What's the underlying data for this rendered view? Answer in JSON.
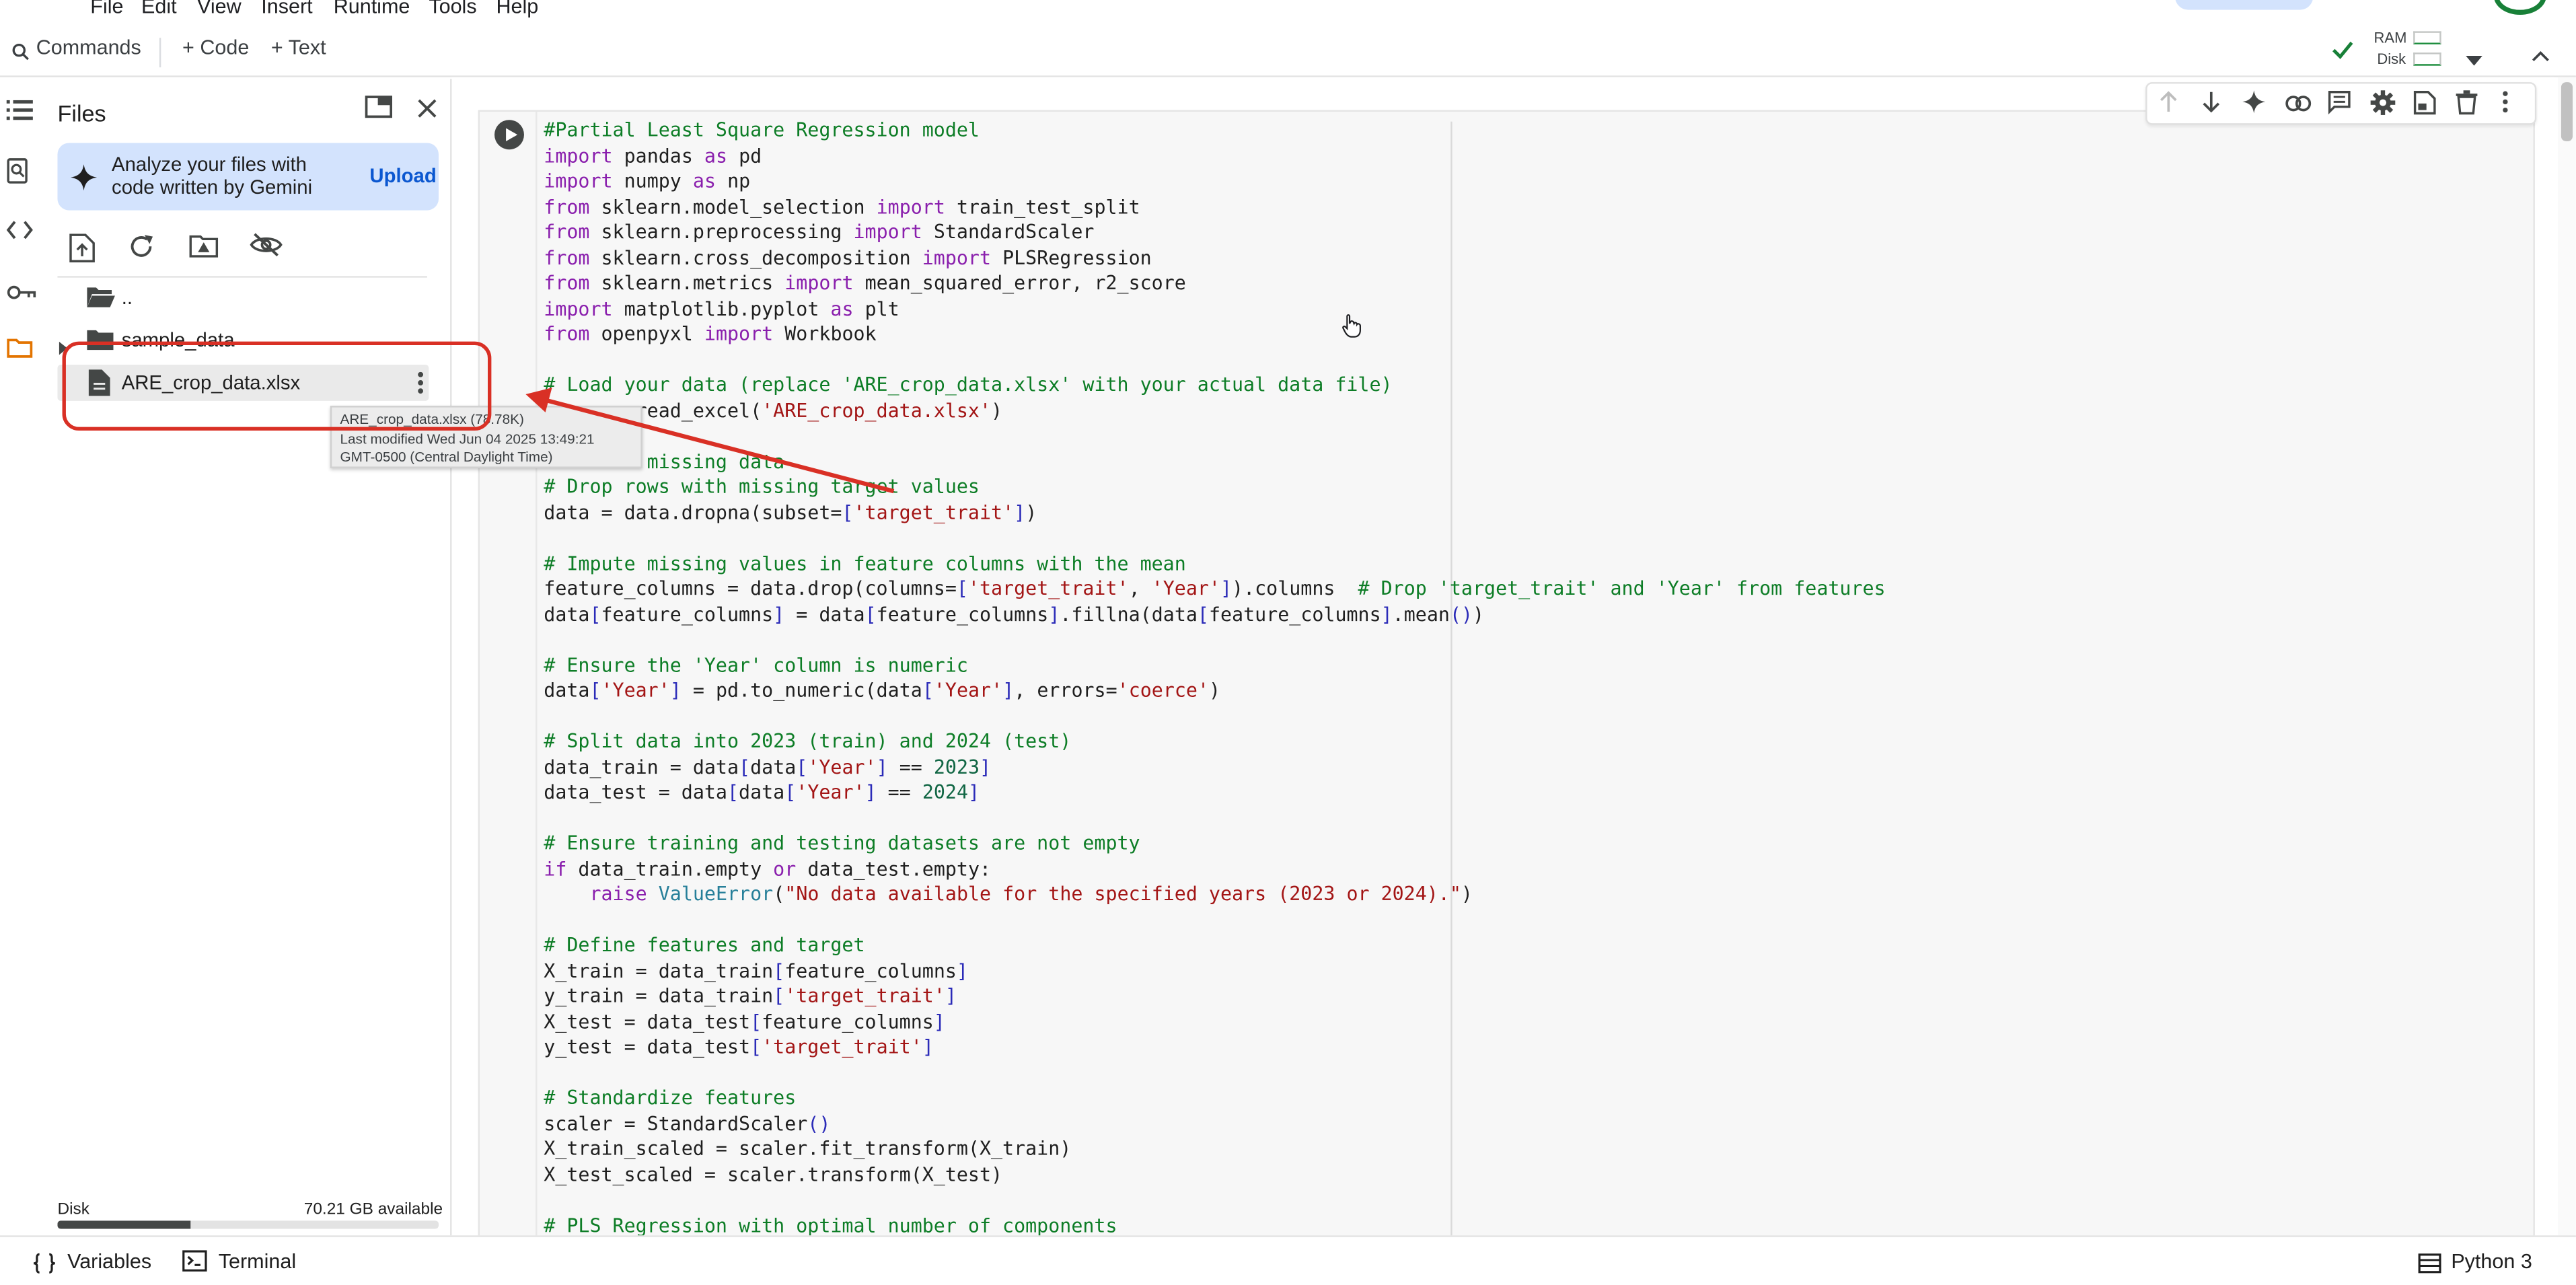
{
  "menu": [
    "File",
    "Edit",
    "View",
    "Insert",
    "Runtime",
    "Tools",
    "Help"
  ],
  "toolbar": {
    "commands_label": "Commands",
    "add_code_label": "+ Code",
    "add_text_label": "+ Text",
    "ram_label": "RAM",
    "disk_label": "Disk"
  },
  "rail": {
    "icons": [
      "table-of-contents-icon",
      "find-replace-icon",
      "code-snippets-icon",
      "secrets-key-icon",
      "folder-icon"
    ]
  },
  "files_panel": {
    "title": "Files",
    "gemini_text": "Analyze your files with code written by Gemini",
    "upload_label": "Upload",
    "tree": [
      {
        "label": "..",
        "type": "folder"
      },
      {
        "label": "sample_data",
        "type": "folder"
      },
      {
        "label": "ARE_crop_data.xlsx",
        "type": "file"
      }
    ],
    "disk_label": "Disk",
    "disk_available": "70.21 GB available",
    "disk_used_fraction": 0.35
  },
  "tooltip": {
    "line1": "ARE_crop_data.xlsx (78.78K)",
    "line2": "Last modified Wed Jun 04 2025 13:49:21",
    "line3": "GMT-0500 (Central Daylight Time)"
  },
  "code_lines": [
    [
      {
        "t": "#Partial Least Square Regression model",
        "c": "c-comment"
      }
    ],
    [
      {
        "t": "import",
        "c": "c-kw"
      },
      {
        "t": " pandas "
      },
      {
        "t": "as",
        "c": "c-kw"
      },
      {
        "t": " pd"
      }
    ],
    [
      {
        "t": "import",
        "c": "c-kw"
      },
      {
        "t": " numpy "
      },
      {
        "t": "as",
        "c": "c-kw"
      },
      {
        "t": " np"
      }
    ],
    [
      {
        "t": "from",
        "c": "c-kw"
      },
      {
        "t": " sklearn.model_selection "
      },
      {
        "t": "import",
        "c": "c-kw"
      },
      {
        "t": " train_test_split"
      }
    ],
    [
      {
        "t": "from",
        "c": "c-kw"
      },
      {
        "t": " sklearn.preprocessing "
      },
      {
        "t": "import",
        "c": "c-kw"
      },
      {
        "t": " StandardScaler"
      }
    ],
    [
      {
        "t": "from",
        "c": "c-kw"
      },
      {
        "t": " sklearn.cross_decomposition "
      },
      {
        "t": "import",
        "c": "c-kw"
      },
      {
        "t": " PLSRegression"
      }
    ],
    [
      {
        "t": "from",
        "c": "c-kw"
      },
      {
        "t": " sklearn.metrics "
      },
      {
        "t": "import",
        "c": "c-kw"
      },
      {
        "t": " mean_squared_error, r2_score"
      }
    ],
    [
      {
        "t": "import",
        "c": "c-kw"
      },
      {
        "t": " matplotlib.pyplot "
      },
      {
        "t": "as",
        "c": "c-kw"
      },
      {
        "t": " plt"
      }
    ],
    [
      {
        "t": "from",
        "c": "c-kw"
      },
      {
        "t": " openpyxl "
      },
      {
        "t": "import",
        "c": "c-kw"
      },
      {
        "t": " Workbook"
      }
    ],
    [],
    [
      {
        "t": "# Load your data (replace 'ARE_crop_data.xlsx' with your actual data file)",
        "c": "c-comment"
      }
    ],
    [
      {
        "t": "       .read_excel("
      },
      {
        "t": "'ARE_crop_data.xlsx'",
        "c": "c-str"
      },
      {
        "t": ")"
      }
    ],
    [],
    [
      {
        "t": "#        missing data",
        "c": "c-comment"
      }
    ],
    [
      {
        "t": "# Drop rows with missing target values",
        "c": "c-comment"
      }
    ],
    [
      {
        "t": "data = data.dropna(subset="
      },
      {
        "t": "[",
        "c": "c-blue"
      },
      {
        "t": "'target_trait'",
        "c": "c-str"
      },
      {
        "t": "]",
        "c": "c-blue"
      },
      {
        "t": ")"
      }
    ],
    [],
    [
      {
        "t": "# Impute missing values in feature columns with the mean",
        "c": "c-comment"
      }
    ],
    [
      {
        "t": "feature_columns = data.drop(columns="
      },
      {
        "t": "[",
        "c": "c-blue"
      },
      {
        "t": "'target_trait'",
        "c": "c-str"
      },
      {
        "t": ", "
      },
      {
        "t": "'Year'",
        "c": "c-str"
      },
      {
        "t": "]",
        "c": "c-blue"
      },
      {
        "t": ").columns  "
      },
      {
        "t": "# Drop 'target_trait' and 'Year' from features",
        "c": "c-comment"
      }
    ],
    [
      {
        "t": "data"
      },
      {
        "t": "[",
        "c": "c-blue"
      },
      {
        "t": "feature_columns"
      },
      {
        "t": "]",
        "c": "c-blue"
      },
      {
        "t": " = data"
      },
      {
        "t": "[",
        "c": "c-blue"
      },
      {
        "t": "feature_columns"
      },
      {
        "t": "]",
        "c": "c-blue"
      },
      {
        "t": ".fillna(data"
      },
      {
        "t": "[",
        "c": "c-blue"
      },
      {
        "t": "feature_columns"
      },
      {
        "t": "]",
        "c": "c-blue"
      },
      {
        "t": ".mean"
      },
      {
        "t": "()",
        "c": "c-blue"
      },
      {
        "t": ")"
      }
    ],
    [],
    [
      {
        "t": "# Ensure the 'Year' column is numeric",
        "c": "c-comment"
      }
    ],
    [
      {
        "t": "data"
      },
      {
        "t": "[",
        "c": "c-blue"
      },
      {
        "t": "'Year'",
        "c": "c-str"
      },
      {
        "t": "]",
        "c": "c-blue"
      },
      {
        "t": " = pd.to_numeric(data"
      },
      {
        "t": "[",
        "c": "c-blue"
      },
      {
        "t": "'Year'",
        "c": "c-str"
      },
      {
        "t": "]",
        "c": "c-blue"
      },
      {
        "t": ", errors="
      },
      {
        "t": "'coerce'",
        "c": "c-str"
      },
      {
        "t": ")"
      }
    ],
    [],
    [
      {
        "t": "# Split data into 2023 (train) and 2024 (test)",
        "c": "c-comment"
      }
    ],
    [
      {
        "t": "data_train = data"
      },
      {
        "t": "[",
        "c": "c-blue"
      },
      {
        "t": "data"
      },
      {
        "t": "[",
        "c": "c-blue"
      },
      {
        "t": "'Year'",
        "c": "c-str"
      },
      {
        "t": "]",
        "c": "c-blue"
      },
      {
        "t": " == "
      },
      {
        "t": "2023",
        "c": "c-num"
      },
      {
        "t": "]",
        "c": "c-blue"
      }
    ],
    [
      {
        "t": "data_test = data"
      },
      {
        "t": "[",
        "c": "c-blue"
      },
      {
        "t": "data"
      },
      {
        "t": "[",
        "c": "c-blue"
      },
      {
        "t": "'Year'",
        "c": "c-str"
      },
      {
        "t": "]",
        "c": "c-blue"
      },
      {
        "t": " == "
      },
      {
        "t": "2024",
        "c": "c-num"
      },
      {
        "t": "]",
        "c": "c-blue"
      }
    ],
    [],
    [
      {
        "t": "# Ensure training and testing datasets are not empty",
        "c": "c-comment"
      }
    ],
    [
      {
        "t": "if",
        "c": "c-kw"
      },
      {
        "t": " data_train.empty "
      },
      {
        "t": "or",
        "c": "c-kw"
      },
      {
        "t": " data_test.empty:"
      }
    ],
    [
      {
        "t": "    "
      },
      {
        "t": "raise",
        "c": "c-kw"
      },
      {
        "t": " "
      },
      {
        "t": "ValueError",
        "c": "c-cls"
      },
      {
        "t": "("
      },
      {
        "t": "\"No data available for the specified years (2023 or 2024).\"",
        "c": "c-str"
      },
      {
        "t": ")"
      }
    ],
    [],
    [
      {
        "t": "# Define features and target",
        "c": "c-comment"
      }
    ],
    [
      {
        "t": "X_train = data_train"
      },
      {
        "t": "[",
        "c": "c-blue"
      },
      {
        "t": "feature_columns"
      },
      {
        "t": "]",
        "c": "c-blue"
      }
    ],
    [
      {
        "t": "y_train = data_train"
      },
      {
        "t": "[",
        "c": "c-blue"
      },
      {
        "t": "'target_trait'",
        "c": "c-str"
      },
      {
        "t": "]",
        "c": "c-blue"
      }
    ],
    [
      {
        "t": "X_test = data_test"
      },
      {
        "t": "[",
        "c": "c-blue"
      },
      {
        "t": "feature_columns"
      },
      {
        "t": "]",
        "c": "c-blue"
      }
    ],
    [
      {
        "t": "y_test = data_test"
      },
      {
        "t": "[",
        "c": "c-blue"
      },
      {
        "t": "'target_trait'",
        "c": "c-str"
      },
      {
        "t": "]",
        "c": "c-blue"
      }
    ],
    [],
    [
      {
        "t": "# Standardize features",
        "c": "c-comment"
      }
    ],
    [
      {
        "t": "scaler = StandardScaler"
      },
      {
        "t": "()",
        "c": "c-blue"
      }
    ],
    [
      {
        "t": "X_train_scaled = scaler.fit_transform(X_train)"
      }
    ],
    [
      {
        "t": "X_test_scaled = scaler.transform(X_test)"
      }
    ],
    [],
    [
      {
        "t": "# PLS Regression with optimal number of components",
        "c": "c-comment"
      }
    ]
  ],
  "status_bar": {
    "variables_label": "Variables",
    "terminal_label": "Terminal",
    "runtime_label": "Python 3"
  },
  "colors": {
    "accent_blue": "#0b57d0",
    "annotation_red": "#d93025",
    "gemini_bg": "#d3e3fd",
    "connected_green": "#188038"
  }
}
